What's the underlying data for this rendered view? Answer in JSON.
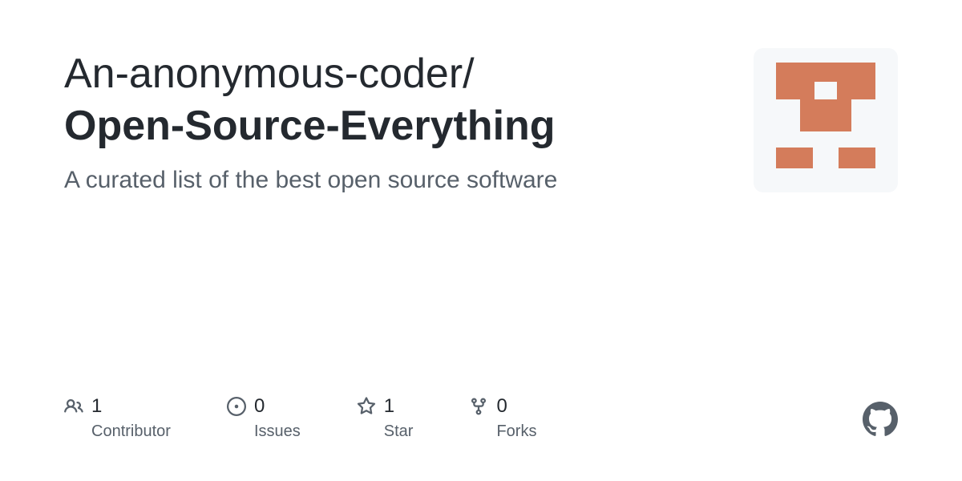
{
  "repo": {
    "owner": "An-anonymous-coder",
    "separator": "/",
    "name": "Open-Source-Everything",
    "description": "A curated list of the best open source software"
  },
  "stats": {
    "contributors": {
      "count": "1",
      "label": "Contributor"
    },
    "issues": {
      "count": "0",
      "label": "Issues"
    },
    "stars": {
      "count": "1",
      "label": "Star"
    },
    "forks": {
      "count": "0",
      "label": "Forks"
    }
  },
  "colors": {
    "text_primary": "#24292f",
    "text_muted": "#57606a",
    "avatar_bg": "#f6f8fa",
    "avatar_accent": "#d47c5b"
  }
}
